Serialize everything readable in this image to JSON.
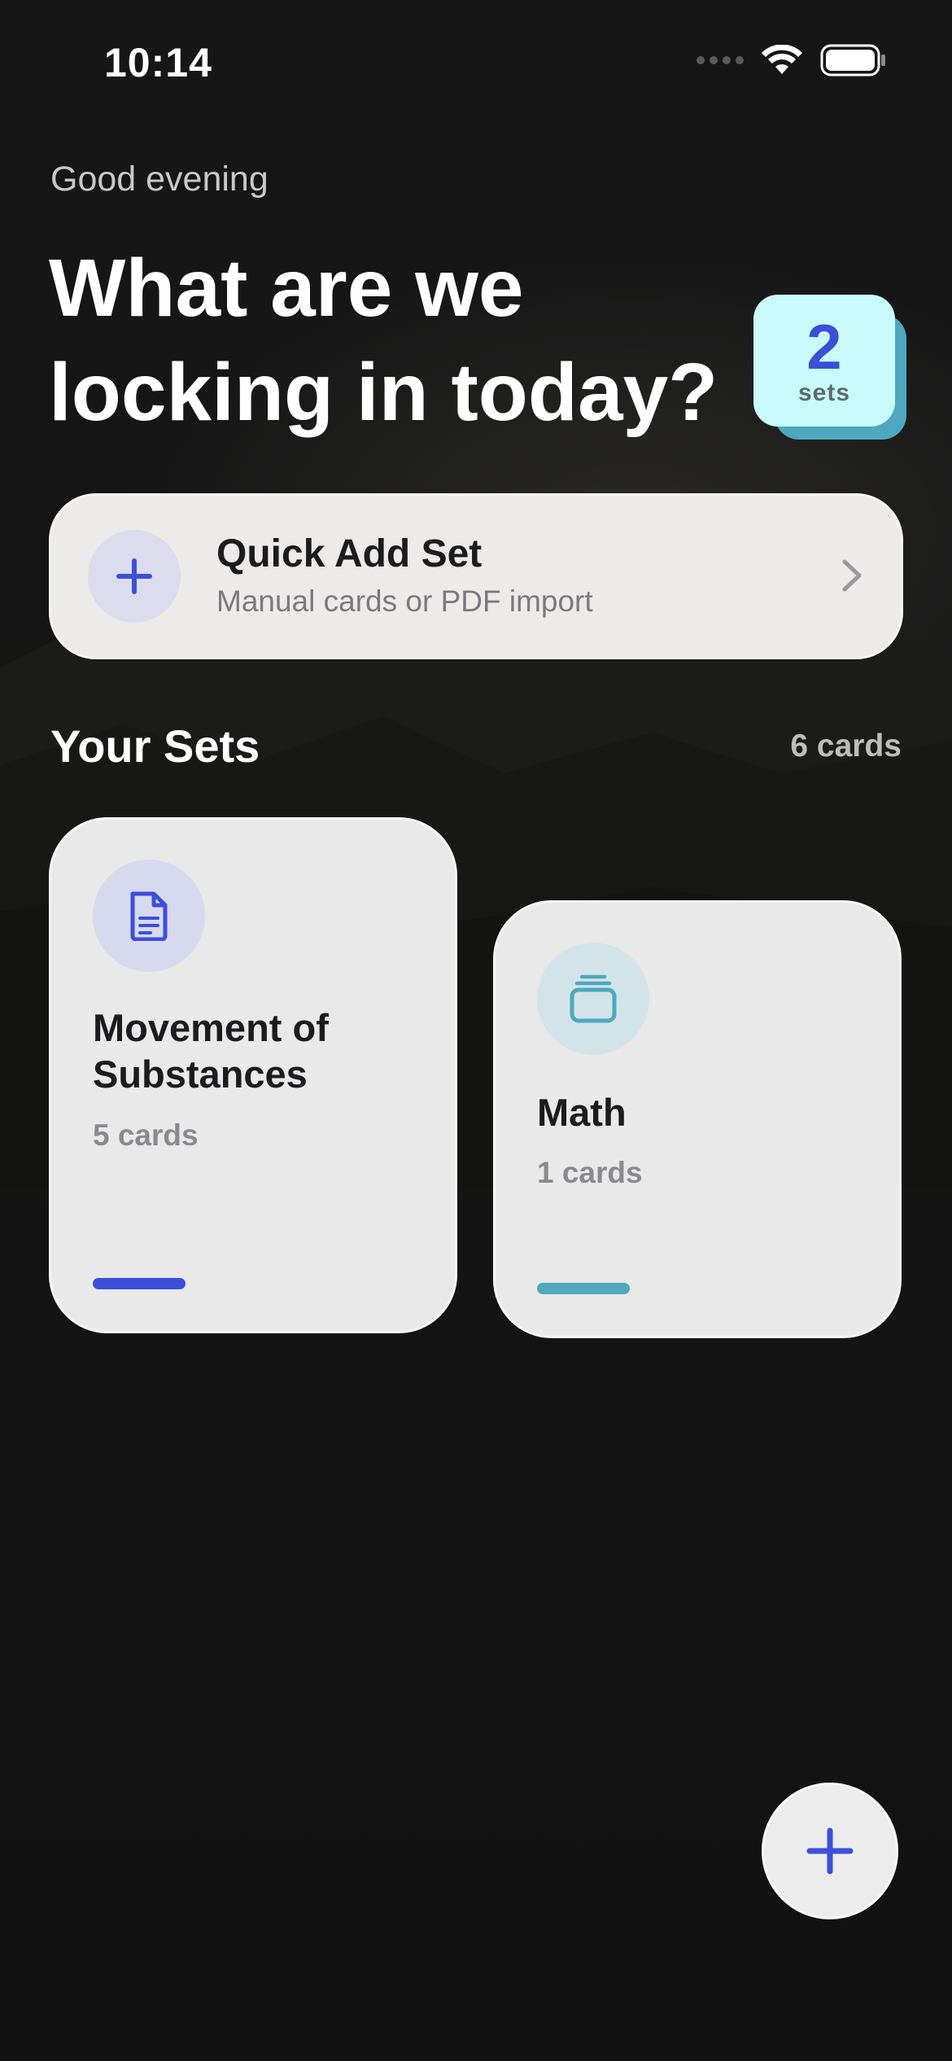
{
  "status_bar": {
    "time": "10:14"
  },
  "header": {
    "greeting": "Good evening",
    "headline": "What are we locking in today?",
    "sets_badge": {
      "count": "2",
      "label": "sets"
    }
  },
  "quick_add": {
    "title": "Quick Add Set",
    "subtitle": "Manual cards or PDF import",
    "icon": "plus-icon",
    "chevron_icon": "chevron-right-icon"
  },
  "section": {
    "title": "Your Sets",
    "total": "6 cards"
  },
  "sets": [
    {
      "title": "Movement of Substances",
      "count": "5 cards",
      "icon": "document-icon",
      "accent": "#3d4fd8"
    },
    {
      "title": "Math",
      "count": "1 cards",
      "icon": "stack-icon",
      "accent": "#4ea8bf"
    }
  ],
  "fab": {
    "icon": "plus-icon"
  },
  "colors": {
    "primary": "#3d4fd8",
    "teal": "#4ea8bf",
    "badge_bg": "#c9fbfc",
    "card_bg": "#e9e9e9",
    "background": "#141414"
  }
}
